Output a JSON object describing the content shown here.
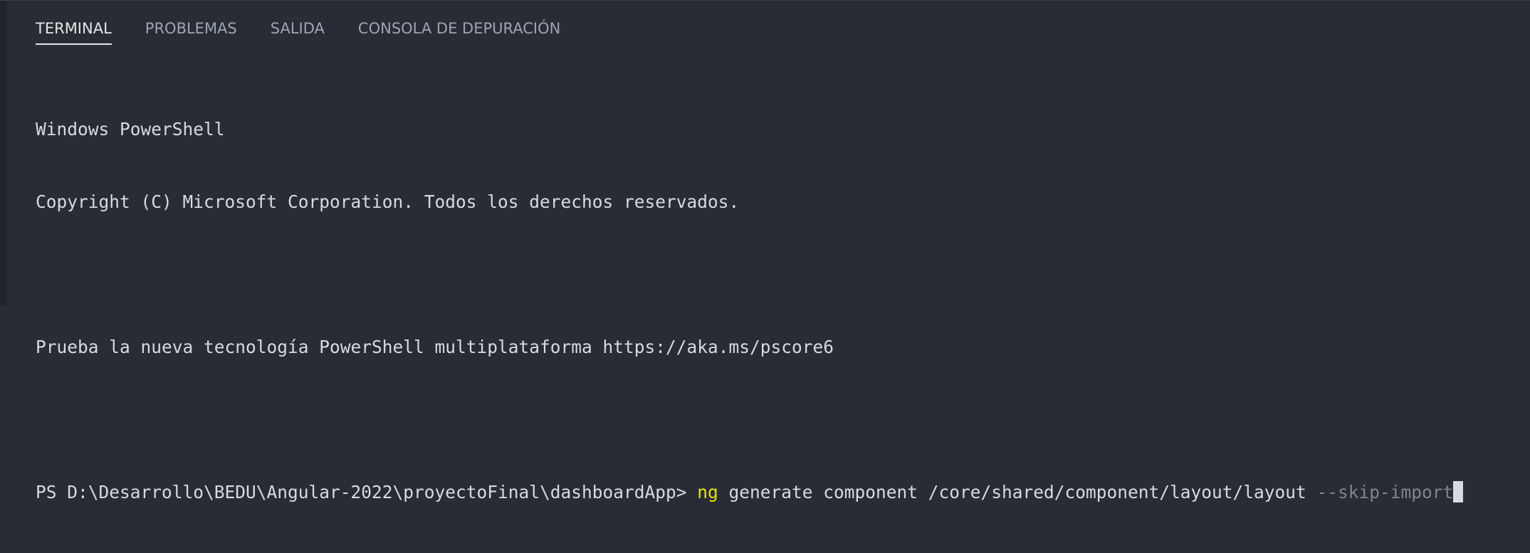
{
  "tabs": [
    {
      "label": "TERMINAL",
      "active": true
    },
    {
      "label": "PROBLEMAS",
      "active": false
    },
    {
      "label": "SALIDA",
      "active": false
    },
    {
      "label": "CONSOLA DE DEPURACIÓN",
      "active": false
    }
  ],
  "terminal": {
    "line1": "Windows PowerShell",
    "line2": "Copyright (C) Microsoft Corporation. Todos los derechos reservados.",
    "line3": "",
    "line4": "Prueba la nueva tecnología PowerShell multiplataforma https://aka.ms/pscore6",
    "line5": "",
    "prompt": "PS D:\\Desarrollo\\BEDU\\Angular-2022\\proyectoFinal\\dashboardApp> ",
    "command": {
      "executable": "ng",
      "args": " generate component /core/shared/component/layout/layout ",
      "flag": "--skip-import"
    }
  },
  "colors": {
    "background": "#282c34",
    "text": "#d7dae0",
    "command_highlight": "#e5e510",
    "flag_dim": "#7f848e",
    "tab_inactive": "#9da5b4",
    "tab_active": "#e6e6e6"
  }
}
